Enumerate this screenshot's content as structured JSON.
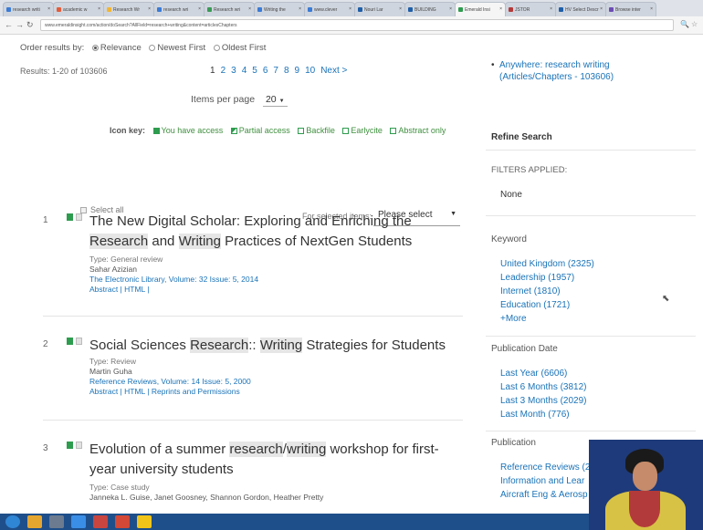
{
  "browser": {
    "tabs": [
      "research writi",
      "academic w",
      "Research Wr",
      "research wri",
      "Research wri",
      "Writing the",
      "www.clever",
      "Nouri Lar",
      "BUILDING",
      "Emerald Insi",
      "JSTOR",
      "HV Select Descr",
      "Browse inter"
    ],
    "active_tab": 9,
    "url": "www.emeraldinsight.com/action/doSearch?AllField=research+writing&content=articlesChapters"
  },
  "search": {
    "order_label": "Order results by:",
    "order_options": [
      "Relevance",
      "Newest First",
      "Oldest First"
    ],
    "order_selected": "Relevance",
    "results_count": "Results: 1-20 of 103606",
    "pages": [
      "1",
      "2",
      "3",
      "4",
      "5",
      "6",
      "7",
      "8",
      "9",
      "10"
    ],
    "next_label": "Next >",
    "items_per_page_label": "Items per page",
    "items_per_page_value": "20",
    "icon_key_label": "Icon key:",
    "icon_key": [
      "You have access",
      "Partial access",
      "Backfile",
      "Earlycite",
      "Abstract only"
    ],
    "select_all_label": "Select all",
    "for_selected_label": "For selected items:",
    "for_selected_value": "Please select"
  },
  "results": [
    {
      "number": "1",
      "title_parts": [
        {
          "t": "The New Digital Scholar: Exploring and Enriching the ",
          "hl": false
        },
        {
          "t": "Research",
          "hl": true
        },
        {
          "t": " and ",
          "hl": false
        },
        {
          "t": "Writing",
          "hl": true
        },
        {
          "t": " Practices of NextGen Students",
          "hl": false
        }
      ],
      "type": "Type: General review",
      "authors": "Sahar Azizian",
      "source": "The Electronic Library, Volume: 32 Issue: 5, 2014",
      "links": "Abstract | HTML |"
    },
    {
      "number": "2",
      "title_parts": [
        {
          "t": "Social Sciences ",
          "hl": false
        },
        {
          "t": "Research",
          "hl": true
        },
        {
          "t": ":: ",
          "hl": false
        },
        {
          "t": "Writing",
          "hl": true
        },
        {
          "t": " Strategies for Students",
          "hl": false
        }
      ],
      "type": "Type: Review",
      "authors": "Martin Guha",
      "source": "Reference Reviews, Volume: 14 Issue: 5, 2000",
      "links": "Abstract | HTML | Reprints and Permissions"
    },
    {
      "number": "3",
      "title_parts": [
        {
          "t": "Evolution of a summer ",
          "hl": false
        },
        {
          "t": "research",
          "hl": true
        },
        {
          "t": "/",
          "hl": false
        },
        {
          "t": "writing",
          "hl": true
        },
        {
          "t": " workshop for first-year university students",
          "hl": false
        }
      ],
      "type": "Type: Case study",
      "authors": "Janneka L. Guise, Janet Goosney, Shannon Gordon, Heather Pretty",
      "source": "",
      "links": ""
    }
  ],
  "sidebar": {
    "anywhere": "Anywhere: research writing (Articles/Chapters - 103606)",
    "refine_title": "Refine Search",
    "filters_label": "FILTERS APPLIED:",
    "filters_value": "None",
    "keyword_title": "Keyword",
    "keywords": [
      "United Kingdom (2325)",
      "Leadership (1957)",
      "Internet (1810)",
      "Education (1721)",
      "+More"
    ],
    "pubdate_title": "Publication Date",
    "pubdates": [
      "Last Year (6606)",
      "Last 6 Months (3812)",
      "Last 3 Months (2029)",
      "Last Month (776)"
    ],
    "publication_title": "Publication",
    "publications": [
      "Reference Reviews (2",
      "Information and Lear",
      "Aircraft Eng & Aerosp"
    ]
  },
  "colors": {
    "link": "#1a73b8",
    "access_green": "#2e9c4e",
    "highlight": "#e6e6e6",
    "taskbar": "#1f4f8a"
  }
}
